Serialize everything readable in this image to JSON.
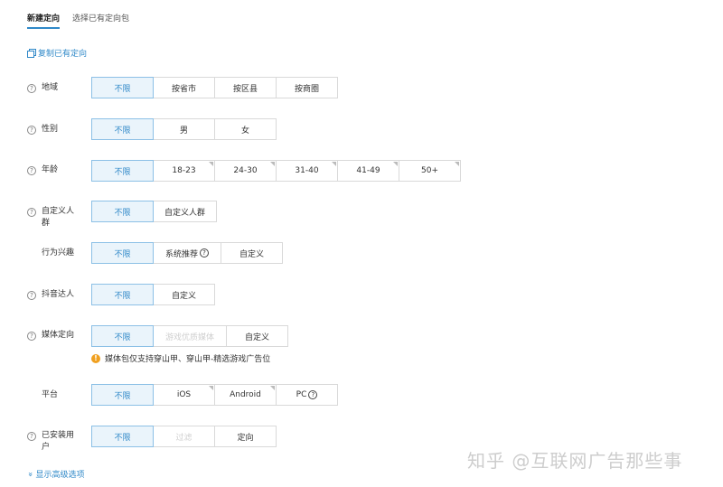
{
  "tabs": [
    {
      "label": "新建定向",
      "active": true
    },
    {
      "label": "选择已有定向包",
      "active": false
    }
  ],
  "copy_link": {
    "icon": "copy-icon",
    "label": "复制已有定向"
  },
  "rows": {
    "region": {
      "label": "地域",
      "options": [
        "不限",
        "按省市",
        "按区县",
        "按商圈"
      ]
    },
    "gender": {
      "label": "性别",
      "options": [
        "不限",
        "男",
        "女"
      ]
    },
    "age": {
      "label": "年龄",
      "options": [
        "不限",
        "18-23",
        "24-30",
        "31-40",
        "41-49",
        "50+"
      ]
    },
    "custom_audience": {
      "label_line1": "自定义人",
      "label_line2": "群",
      "options": [
        "不限",
        "自定义人群"
      ]
    },
    "interest": {
      "label": "行为兴趣",
      "options": [
        "不限",
        "系统推荐",
        "自定义"
      ]
    },
    "douyin": {
      "label": "抖音达人",
      "options": [
        "不限",
        "自定义"
      ]
    },
    "media": {
      "label": "媒体定向",
      "options": [
        "不限",
        "游戏优质媒体",
        "自定义"
      ]
    },
    "platform": {
      "label": "平台",
      "options": [
        "不限",
        "iOS",
        "Android",
        "PC"
      ]
    },
    "installed": {
      "label_line1": "已安装用",
      "label_line2": "户",
      "options": [
        "不限",
        "过滤",
        "定向"
      ]
    }
  },
  "media_note": "媒体包仅支持穿山甲、穿山甲-精选游戏广告位",
  "advanced_link": "显示高级选项",
  "watermark": "知乎 @互联网广告那些事",
  "colors": {
    "accent": "#2f88c8",
    "selected_bg": "#eaf4fb",
    "warning": "#f0a020"
  }
}
